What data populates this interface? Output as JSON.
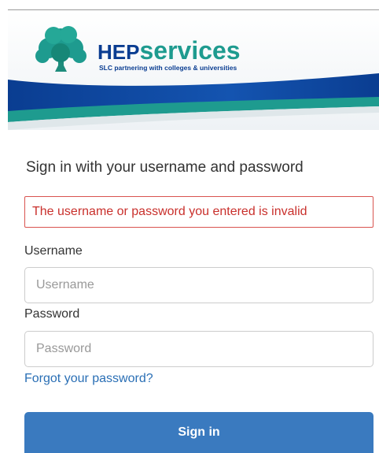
{
  "banner": {
    "brand_hep": "HEP",
    "brand_services": "services",
    "tagline": "SLC partnering with colleges & universities",
    "logo_icon": "tree-logo-icon",
    "colors": {
      "teal": "#1e9b8f",
      "navy": "#0a3d91",
      "accent_blue": "#1a5fb4"
    }
  },
  "form": {
    "heading": "Sign in with your username and password",
    "error": "The username or password you entered is invalid",
    "username_label": "Username",
    "username_placeholder": "Username",
    "username_value": "",
    "password_label": "Password",
    "password_placeholder": "Password",
    "password_value": "",
    "forgot_link": "Forgot your password?",
    "submit_label": "Sign in",
    "colors": {
      "error": "#c9302c",
      "link": "#2a6fb5",
      "button": "#3a7abf"
    }
  }
}
